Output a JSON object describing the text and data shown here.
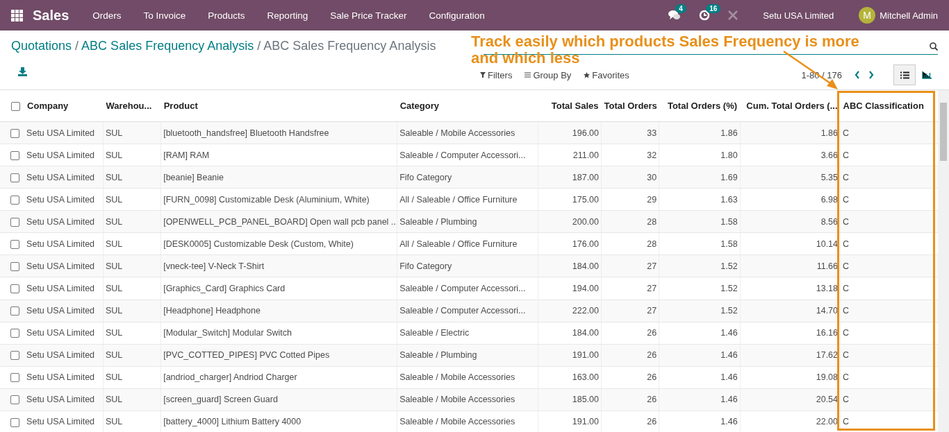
{
  "navbar": {
    "app": "Sales",
    "menu": [
      "Orders",
      "To Invoice",
      "Products",
      "Reporting",
      "Sale Price Tracker",
      "Configuration"
    ],
    "messages_count": "4",
    "activities_count": "16",
    "company": "Setu USA Limited",
    "avatar_letter": "M",
    "user": "Mitchell Admin"
  },
  "breadcrumb_separator": "/",
  "breadcrumbs": [
    {
      "label": "Quotations",
      "current": false
    },
    {
      "label": "ABC Sales Frequency Analysis",
      "current": false
    },
    {
      "label": "ABC Sales Frequency Analysis",
      "current": true
    }
  ],
  "search_menus": [
    "Filters",
    "Group By",
    "Favorites"
  ],
  "pager": "1-80 / 176",
  "views": [
    {
      "kind": "list",
      "selected": true
    },
    {
      "kind": "graph",
      "selected": false
    }
  ],
  "annotation": "Track easily which products Sales Frequency is more and which less",
  "table": {
    "select_all_checked": false,
    "columns": [
      {
        "label": "Company",
        "kind": "text"
      },
      {
        "label": "Warehou...",
        "kind": "text"
      },
      {
        "label": "Product",
        "kind": "text"
      },
      {
        "label": "Category",
        "kind": "text"
      },
      {
        "label": "Total Sales",
        "kind": "number"
      },
      {
        "label": "Total Orders",
        "kind": "number"
      },
      {
        "label": "Total Orders (%)",
        "kind": "number"
      },
      {
        "label": "Cum. Total Orders (...",
        "kind": "number"
      },
      {
        "label": "ABC Classification",
        "kind": "text"
      }
    ],
    "rows": [
      {
        "checked": false,
        "cells": [
          "Setu USA Limited",
          "SUL",
          "[bluetooth_handsfree] Bluetooth Handsfree",
          "Saleable / Mobile Accessories",
          "196.00",
          "33",
          "1.86",
          "1.86",
          "C"
        ]
      },
      {
        "checked": false,
        "cells": [
          "Setu USA Limited",
          "SUL",
          "[RAM] RAM",
          "Saleable / Computer Accessori...",
          "211.00",
          "32",
          "1.80",
          "3.66",
          "C"
        ]
      },
      {
        "checked": false,
        "cells": [
          "Setu USA Limited",
          "SUL",
          "[beanie] Beanie",
          "Fifo Category",
          "187.00",
          "30",
          "1.69",
          "5.35",
          "C"
        ]
      },
      {
        "checked": false,
        "cells": [
          "Setu USA Limited",
          "SUL",
          "[FURN_0098] Customizable Desk (Aluminium, White)",
          "All / Saleable / Office Furniture",
          "175.00",
          "29",
          "1.63",
          "6.98",
          "C"
        ]
      },
      {
        "checked": false,
        "cells": [
          "Setu USA Limited",
          "SUL",
          "[OPENWELL_PCB_PANEL_BOARD] Open wall pcb panel ...",
          "Saleable / Plumbing",
          "200.00",
          "28",
          "1.58",
          "8.56",
          "C"
        ]
      },
      {
        "checked": false,
        "cells": [
          "Setu USA Limited",
          "SUL",
          "[DESK0005] Customizable Desk (Custom, White)",
          "All / Saleable / Office Furniture",
          "176.00",
          "28",
          "1.58",
          "10.14",
          "C"
        ]
      },
      {
        "checked": false,
        "cells": [
          "Setu USA Limited",
          "SUL",
          "[vneck-tee] V-Neck T-Shirt",
          "Fifo Category",
          "184.00",
          "27",
          "1.52",
          "11.66",
          "C"
        ]
      },
      {
        "checked": false,
        "cells": [
          "Setu USA Limited",
          "SUL",
          "[Graphics_Card] Graphics Card",
          "Saleable / Computer Accessori...",
          "194.00",
          "27",
          "1.52",
          "13.18",
          "C"
        ]
      },
      {
        "checked": false,
        "cells": [
          "Setu USA Limited",
          "SUL",
          "[Headphone] Headphone",
          "Saleable / Computer Accessori...",
          "222.00",
          "27",
          "1.52",
          "14.70",
          "C"
        ]
      },
      {
        "checked": false,
        "cells": [
          "Setu USA Limited",
          "SUL",
          "[Modular_Switch] Modular Switch",
          "Saleable / Electric",
          "184.00",
          "26",
          "1.46",
          "16.16",
          "C"
        ]
      },
      {
        "checked": false,
        "cells": [
          "Setu USA Limited",
          "SUL",
          "[PVC_COTTED_PIPES] PVC Cotted Pipes",
          "Saleable / Plumbing",
          "191.00",
          "26",
          "1.46",
          "17.62",
          "C"
        ]
      },
      {
        "checked": false,
        "cells": [
          "Setu USA Limited",
          "SUL",
          "[andriod_charger] Andriod Charger",
          "Saleable / Mobile Accessories",
          "163.00",
          "26",
          "1.46",
          "19.08",
          "C"
        ]
      },
      {
        "checked": false,
        "cells": [
          "Setu USA Limited",
          "SUL",
          "[screen_guard] Screen Guard",
          "Saleable / Mobile Accessories",
          "185.00",
          "26",
          "1.46",
          "20.54",
          "C"
        ]
      },
      {
        "checked": false,
        "cells": [
          "Setu USA Limited",
          "SUL",
          "[battery_4000] Lithium Battery 4000",
          "Saleable / Mobile Accessories",
          "191.00",
          "26",
          "1.46",
          "22.00",
          "C"
        ]
      }
    ]
  }
}
